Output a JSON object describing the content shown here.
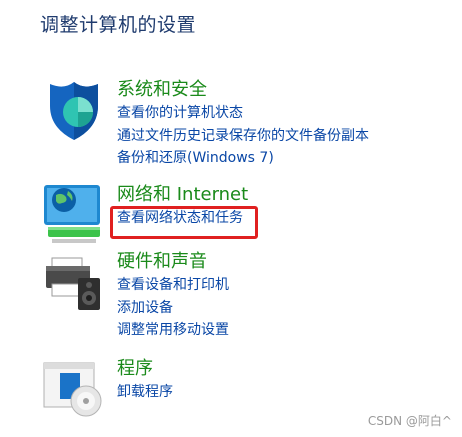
{
  "page_title": "调整计算机的设置",
  "categories": [
    {
      "title": "系统和安全",
      "icon": "shield-icon",
      "links": [
        "查看你的计算机状态",
        "通过文件历史记录保存你的文件备份副本",
        "备份和还原(Windows 7)"
      ]
    },
    {
      "title": "网络和 Internet",
      "icon": "network-globe-icon",
      "links": [
        "查看网络状态和任务"
      ]
    },
    {
      "title": "硬件和声音",
      "icon": "printer-speaker-icon",
      "links": [
        "查看设备和打印机",
        "添加设备",
        "调整常用移动设置"
      ]
    },
    {
      "title": "程序",
      "icon": "program-disc-icon",
      "links": [
        "卸载程序"
      ]
    }
  ],
  "watermark": "CSDN @阿白^",
  "colors": {
    "title_green": "#1a8a1a",
    "link_blue": "#0a47a6",
    "highlight_red": "#e02020"
  }
}
